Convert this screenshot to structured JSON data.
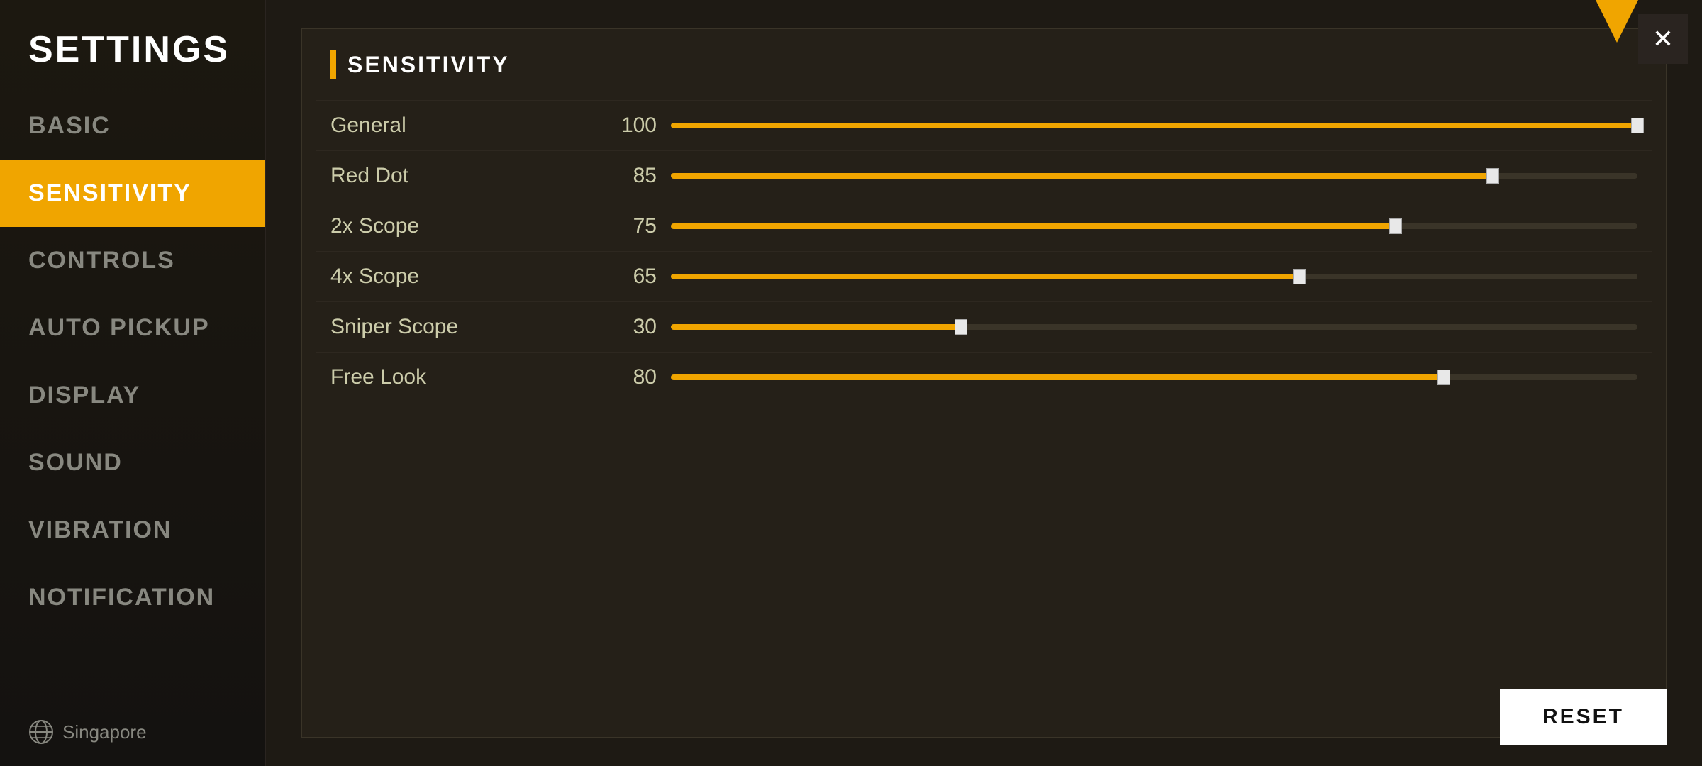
{
  "sidebar": {
    "title": "SETTINGS",
    "items": [
      {
        "id": "basic",
        "label": "BASIC",
        "active": false
      },
      {
        "id": "sensitivity",
        "label": "SENSITIVITY",
        "active": true
      },
      {
        "id": "controls",
        "label": "CONTROLS",
        "active": false
      },
      {
        "id": "auto-pickup",
        "label": "AUTO PICKUP",
        "active": false
      },
      {
        "id": "display",
        "label": "DISPLAY",
        "active": false
      },
      {
        "id": "sound",
        "label": "SOUND",
        "active": false
      },
      {
        "id": "vibration",
        "label": "VIBRATION",
        "active": false
      },
      {
        "id": "notification",
        "label": "NOTIFICATION",
        "active": false
      }
    ],
    "footer": {
      "region": "Singapore"
    }
  },
  "main": {
    "section_title": "SENSITIVITY",
    "sliders": [
      {
        "label": "General",
        "value": 100,
        "max": 100
      },
      {
        "label": "Red Dot",
        "value": 85,
        "max": 100
      },
      {
        "label": "2x Scope",
        "value": 75,
        "max": 100
      },
      {
        "label": "4x Scope",
        "value": 65,
        "max": 100
      },
      {
        "label": "Sniper Scope",
        "value": 30,
        "max": 100
      },
      {
        "label": "Free Look",
        "value": 80,
        "max": 100
      }
    ],
    "reset_button": "RESET",
    "close_button": "✕"
  },
  "colors": {
    "accent": "#f0a500",
    "sidebar_bg": "#1c1810",
    "main_bg": "#1e1a14",
    "active_item": "#f0a500",
    "text_primary": "#ffffff",
    "text_secondary": "#888880",
    "slider_track": "#3a3428",
    "slider_fill": "#f0a500",
    "slider_thumb": "#e8e8e8"
  }
}
